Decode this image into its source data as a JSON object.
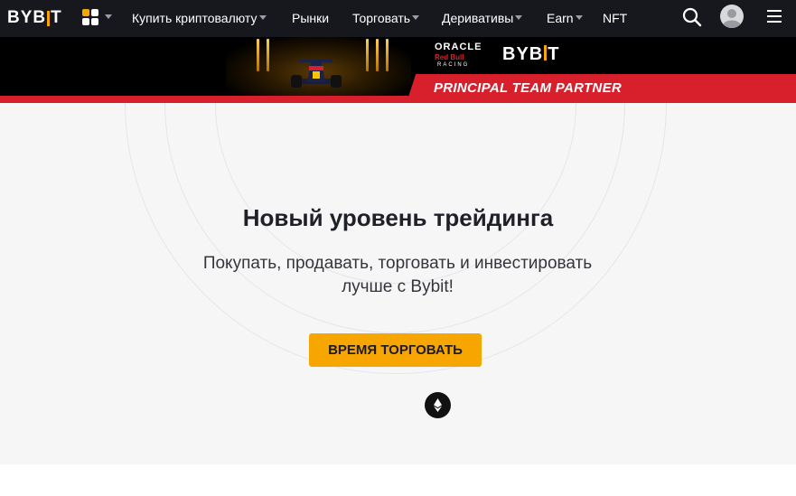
{
  "brand": {
    "logo_left": "BYB",
    "logo_right": "T",
    "accent": "#f7a600"
  },
  "nav": {
    "items": [
      {
        "label": "Купить криптовалюту",
        "dropdown": true
      },
      {
        "label": "Рынки",
        "dropdown": false
      },
      {
        "label": "Торговать",
        "dropdown": true
      },
      {
        "label": "Деривативы",
        "dropdown": true
      },
      {
        "label": "Earn",
        "dropdown": true
      },
      {
        "label": "NFT",
        "dropdown": false
      }
    ],
    "icons": [
      "apps-grid-icon",
      "search-icon",
      "user-avatar-icon",
      "hamburger-menu-icon"
    ]
  },
  "banner": {
    "sponsor_oracle": "ORACLE",
    "sponsor_redbull": "Red Bull",
    "sponsor_racing": "RACING",
    "bybit_left": "BYB",
    "bybit_right": "T",
    "partner_text": "PRINCIPAL TEAM PARTNER",
    "partner_color": "#d8202c"
  },
  "hero": {
    "headline": "Новый уровень трейдинга",
    "subtitle_line1": "Покупать, продавать, торговать и инвестировать",
    "subtitle_line2": "лучше с Bybit!",
    "cta_label": "ВРЕМЯ ТОРГОВАТЬ",
    "scroll_icon": "ethereum-icon"
  }
}
